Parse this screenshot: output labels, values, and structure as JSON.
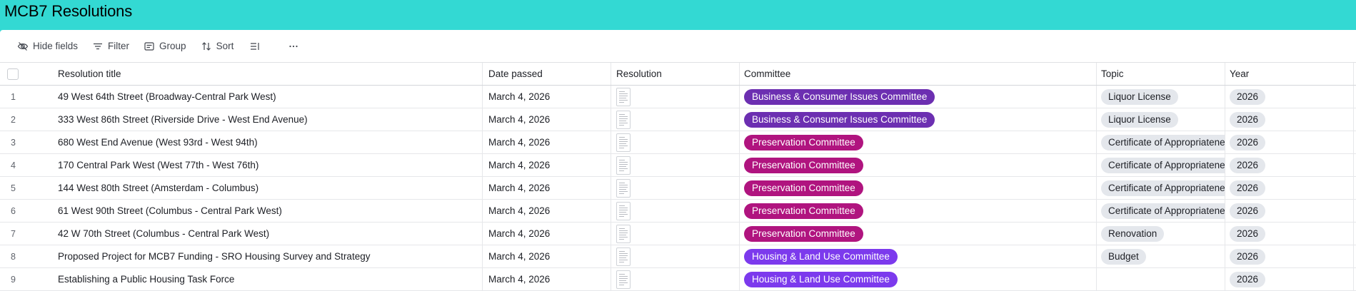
{
  "app": {
    "title": "MCB7 Resolutions"
  },
  "toolbar": {
    "hide_fields": "Hide fields",
    "filter": "Filter",
    "group": "Group",
    "sort": "Sort"
  },
  "columns": {
    "title": "Resolution title",
    "date": "Date passed",
    "resolution": "Resolution",
    "committee": "Committee",
    "topic": "Topic",
    "year": "Year"
  },
  "colors": {
    "header_bg": "#33d9d3",
    "business_committee": "#6c2fb1",
    "preservation_committee": "#b0147f",
    "housing_committee": "#7c3aed",
    "tag_bg": "#e4e7ec"
  },
  "rows": [
    {
      "num": "1",
      "title": "49 West 64th Street (Broadway-Central Park West)",
      "date": "March 4, 2026",
      "committee": "Business & Consumer Issues Committee",
      "committee_color": "#6c2fb1",
      "topic": "Liquor License",
      "year": "2026"
    },
    {
      "num": "2",
      "title": "333 West 86th Street (Riverside Drive - West End Avenue)",
      "date": "March 4, 2026",
      "committee": "Business & Consumer Issues Committee",
      "committee_color": "#6c2fb1",
      "topic": "Liquor License",
      "year": "2026"
    },
    {
      "num": "3",
      "title": "680 West End Avenue (West 93rd - West 94th)",
      "date": "March 4, 2026",
      "committee": "Preservation Committee",
      "committee_color": "#b0147f",
      "topic": "Certificate of Appropriateness",
      "year": "2026"
    },
    {
      "num": "4",
      "title": "170 Central Park West (West 77th - West 76th)",
      "date": "March 4, 2026",
      "committee": "Preservation Committee",
      "committee_color": "#b0147f",
      "topic": "Certificate of Appropriateness",
      "year": "2026"
    },
    {
      "num": "5",
      "title": "144 West 80th Street (Amsterdam - Columbus)",
      "date": "March 4, 2026",
      "committee": "Preservation Committee",
      "committee_color": "#b0147f",
      "topic": "Certificate of Appropriateness",
      "year": "2026"
    },
    {
      "num": "6",
      "title": "61 West 90th Street (Columbus - Central Park West)",
      "date": "March 4, 2026",
      "committee": "Preservation Committee",
      "committee_color": "#b0147f",
      "topic": "Certificate of Appropriateness",
      "year": "2026"
    },
    {
      "num": "7",
      "title": "42 W 70th Street (Columbus - Central Park West)",
      "date": "March 4, 2026",
      "committee": "Preservation Committee",
      "committee_color": "#b0147f",
      "topic": "Renovation",
      "year": "2026"
    },
    {
      "num": "8",
      "title": "Proposed Project for MCB7 Funding - SRO Housing Survey and Strategy",
      "date": "March 4, 2026",
      "committee": "Housing & Land Use Committee",
      "committee_color": "#7c3aed",
      "topic": "Budget",
      "year": "2026"
    },
    {
      "num": "9",
      "title": "Establishing a Public Housing Task Force",
      "date": "March 4, 2026",
      "committee": "Housing & Land Use Committee",
      "committee_color": "#7c3aed",
      "topic": "",
      "year": "2026"
    }
  ]
}
